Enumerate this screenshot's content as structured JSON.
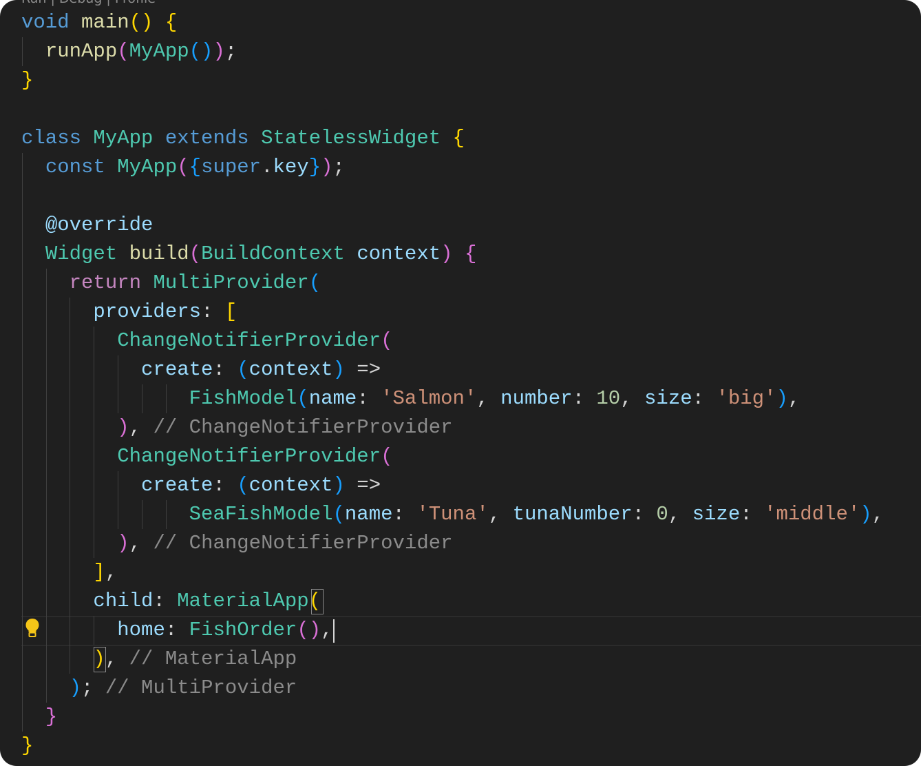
{
  "editor": {
    "codelens": "Run | Debug | Profile",
    "colors": {
      "background": "#1f1f1f",
      "keyword": "#569cd6",
      "control": "#c586c0",
      "type": "#4ec9b0",
      "function": "#dcdcaa",
      "variable": "#9cdcfe",
      "string": "#ce9178",
      "number": "#b5cea8",
      "comment": "#8b8b8b",
      "plain": "#d4d4d4",
      "bracket_gold": "#ffd700",
      "bracket_pink": "#da70d6",
      "bracket_blue": "#179fff"
    },
    "lines": [
      [
        [
          "void",
          "keyword"
        ],
        [
          " ",
          "plain"
        ],
        [
          "main",
          "function"
        ],
        [
          "()",
          "bracket_gold"
        ],
        [
          " ",
          "plain"
        ],
        [
          "{",
          "bracket_gold"
        ]
      ],
      [
        [
          "  ",
          "plain"
        ],
        [
          "runApp",
          "function"
        ],
        [
          "(",
          "bracket_pink"
        ],
        [
          "MyApp",
          "type"
        ],
        [
          "()",
          "bracket_blue"
        ],
        [
          ")",
          "bracket_pink"
        ],
        [
          ";",
          "plain"
        ]
      ],
      [
        [
          "}",
          "bracket_gold"
        ]
      ],
      [],
      [
        [
          "class",
          "keyword"
        ],
        [
          " ",
          "plain"
        ],
        [
          "MyApp",
          "type"
        ],
        [
          " ",
          "plain"
        ],
        [
          "extends",
          "keyword"
        ],
        [
          " ",
          "plain"
        ],
        [
          "StatelessWidget",
          "type"
        ],
        [
          " ",
          "plain"
        ],
        [
          "{",
          "bracket_gold"
        ]
      ],
      [
        [
          "  ",
          "plain"
        ],
        [
          "const",
          "keyword"
        ],
        [
          " ",
          "plain"
        ],
        [
          "MyApp",
          "type"
        ],
        [
          "(",
          "bracket_pink"
        ],
        [
          "{",
          "bracket_blue"
        ],
        [
          "super",
          "keyword"
        ],
        [
          ".",
          "plain"
        ],
        [
          "key",
          "variable"
        ],
        [
          "}",
          "bracket_blue"
        ],
        [
          ")",
          "bracket_pink"
        ],
        [
          ";",
          "plain"
        ]
      ],
      [],
      [
        [
          "  ",
          "plain"
        ],
        [
          "@override",
          "variable"
        ]
      ],
      [
        [
          "  ",
          "plain"
        ],
        [
          "Widget",
          "type"
        ],
        [
          " ",
          "plain"
        ],
        [
          "build",
          "function"
        ],
        [
          "(",
          "bracket_pink"
        ],
        [
          "BuildContext",
          "type"
        ],
        [
          " ",
          "plain"
        ],
        [
          "context",
          "variable"
        ],
        [
          ")",
          "bracket_pink"
        ],
        [
          " ",
          "plain"
        ],
        [
          "{",
          "bracket_pink"
        ]
      ],
      [
        [
          "    ",
          "plain"
        ],
        [
          "return",
          "control"
        ],
        [
          " ",
          "plain"
        ],
        [
          "MultiProvider",
          "type"
        ],
        [
          "(",
          "bracket_blue"
        ]
      ],
      [
        [
          "      ",
          "plain"
        ],
        [
          "providers",
          "variable"
        ],
        [
          ": ",
          "plain"
        ],
        [
          "[",
          "bracket_gold"
        ]
      ],
      [
        [
          "        ",
          "plain"
        ],
        [
          "ChangeNotifierProvider",
          "type"
        ],
        [
          "(",
          "bracket_pink"
        ]
      ],
      [
        [
          "          ",
          "plain"
        ],
        [
          "create",
          "variable"
        ],
        [
          ": ",
          "plain"
        ],
        [
          "(",
          "bracket_blue"
        ],
        [
          "context",
          "variable"
        ],
        [
          ")",
          "bracket_blue"
        ],
        [
          " =>",
          "plain"
        ]
      ],
      [
        [
          "              ",
          "plain"
        ],
        [
          "FishModel",
          "type"
        ],
        [
          "(",
          "bracket_blue"
        ],
        [
          "name",
          "variable"
        ],
        [
          ": ",
          "plain"
        ],
        [
          "'Salmon'",
          "string"
        ],
        [
          ", ",
          "plain"
        ],
        [
          "number",
          "variable"
        ],
        [
          ": ",
          "plain"
        ],
        [
          "10",
          "number"
        ],
        [
          ", ",
          "plain"
        ],
        [
          "size",
          "variable"
        ],
        [
          ": ",
          "plain"
        ],
        [
          "'big'",
          "string"
        ],
        [
          ")",
          "bracket_blue"
        ],
        [
          ",",
          "plain"
        ]
      ],
      [
        [
          "        ",
          "plain"
        ],
        [
          ")",
          "bracket_pink"
        ],
        [
          ", ",
          "plain"
        ],
        [
          "// ChangeNotifierProvider",
          "comment"
        ]
      ],
      [
        [
          "        ",
          "plain"
        ],
        [
          "ChangeNotifierProvider",
          "type"
        ],
        [
          "(",
          "bracket_pink"
        ]
      ],
      [
        [
          "          ",
          "plain"
        ],
        [
          "create",
          "variable"
        ],
        [
          ": ",
          "plain"
        ],
        [
          "(",
          "bracket_blue"
        ],
        [
          "context",
          "variable"
        ],
        [
          ")",
          "bracket_blue"
        ],
        [
          " =>",
          "plain"
        ]
      ],
      [
        [
          "              ",
          "plain"
        ],
        [
          "SeaFishModel",
          "type"
        ],
        [
          "(",
          "bracket_blue"
        ],
        [
          "name",
          "variable"
        ],
        [
          ": ",
          "plain"
        ],
        [
          "'Tuna'",
          "string"
        ],
        [
          ", ",
          "plain"
        ],
        [
          "tunaNumber",
          "variable"
        ],
        [
          ": ",
          "plain"
        ],
        [
          "0",
          "number"
        ],
        [
          ", ",
          "plain"
        ],
        [
          "size",
          "variable"
        ],
        [
          ": ",
          "plain"
        ],
        [
          "'middle'",
          "string"
        ],
        [
          ")",
          "bracket_blue"
        ],
        [
          ",",
          "plain"
        ]
      ],
      [
        [
          "        ",
          "plain"
        ],
        [
          ")",
          "bracket_pink"
        ],
        [
          ", ",
          "plain"
        ],
        [
          "// ChangeNotifierProvider",
          "comment"
        ]
      ],
      [
        [
          "      ",
          "plain"
        ],
        [
          "]",
          "bracket_gold"
        ],
        [
          ",",
          "plain"
        ]
      ],
      [
        [
          "      ",
          "plain"
        ],
        [
          "child",
          "variable"
        ],
        [
          ": ",
          "plain"
        ],
        [
          "MaterialApp",
          "type"
        ],
        [
          "(",
          "bracket_gold"
        ]
      ],
      [
        [
          "        ",
          "plain"
        ],
        [
          "home",
          "variable"
        ],
        [
          ": ",
          "plain"
        ],
        [
          "FishOrder",
          "type"
        ],
        [
          "()",
          "bracket_pink"
        ],
        [
          ",",
          "plain"
        ]
      ],
      [
        [
          "      ",
          "plain"
        ],
        [
          ")",
          "bracket_gold"
        ],
        [
          ", ",
          "plain"
        ],
        [
          "// MaterialApp",
          "comment"
        ]
      ],
      [
        [
          "    ",
          "plain"
        ],
        [
          ")",
          "bracket_blue"
        ],
        [
          "; ",
          "plain"
        ],
        [
          "// MultiProvider",
          "comment"
        ]
      ],
      [
        [
          "  ",
          "plain"
        ],
        [
          "}",
          "bracket_pink"
        ]
      ],
      [
        [
          "}",
          "bracket_gold"
        ]
      ]
    ]
  }
}
